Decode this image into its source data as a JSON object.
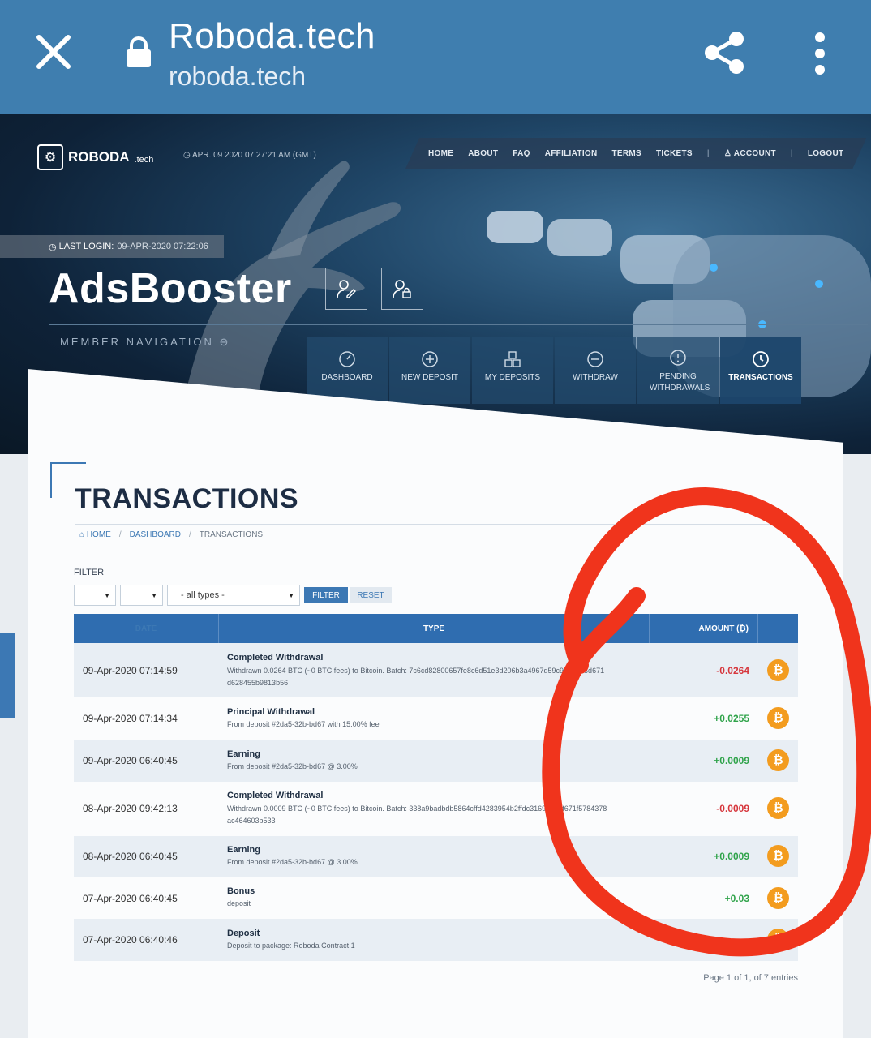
{
  "browser": {
    "title": "Roboda.tech",
    "url": "roboda.tech"
  },
  "site": {
    "brand": "ROBODA",
    "brand_suffix": ".tech",
    "clock": "APR. 09 2020 07:27:21 AM (GMT)",
    "nav": [
      "HOME",
      "ABOUT",
      "FAQ",
      "AFFILIATION",
      "TERMS",
      "TICKETS"
    ],
    "account_label": "ACCOUNT",
    "logout_label": "LOGOUT"
  },
  "member": {
    "last_login_label": "LAST LOGIN:",
    "last_login_value": "09-APR-2020 07:22:06",
    "username": "AdsBooster",
    "nav_label": "MEMBER NAVIGATION"
  },
  "tiles": [
    {
      "label": "DASHBOARD",
      "icon": "gauge-icon"
    },
    {
      "label": "NEW DEPOSIT",
      "icon": "plus-circle-icon"
    },
    {
      "label": "MY DEPOSITS",
      "icon": "cubes-icon"
    },
    {
      "label": "WITHDRAW",
      "icon": "minus-circle-icon"
    },
    {
      "label": "PENDING WITHDRAWALS",
      "icon": "alert-circle-icon"
    },
    {
      "label": "TRANSACTIONS",
      "icon": "history-icon"
    }
  ],
  "page": {
    "title": "TRANSACTIONS",
    "breadcrumb": {
      "home": "HOME",
      "dashboard": "DASHBOARD",
      "current": "TRANSACTIONS"
    }
  },
  "filter": {
    "label": "FILTER",
    "type_select": "- all types -",
    "filter_button": "FILTER",
    "reset_button": "RESET"
  },
  "table": {
    "headers": {
      "date": "DATE",
      "type": "TYPE",
      "amount": "AMOUNT (₿)"
    },
    "rows": [
      {
        "date": "09-Apr-2020 07:14:59",
        "title": "Completed Withdrawal",
        "desc": "Withdrawn 0.0264 BTC (~0 BTC fees) to Bitcoin. Batch: 7c6cd82800657fe8c6d51e3d206b3a4967d59c9383368d671d628455b9813b56",
        "amount": "-0.0264",
        "sign": "neg"
      },
      {
        "date": "09-Apr-2020 07:14:34",
        "title": "Principal Withdrawal",
        "desc": "From deposit #2da5-32b-bd67 with 15.00% fee",
        "amount": "+0.0255",
        "sign": "pos"
      },
      {
        "date": "09-Apr-2020 06:40:45",
        "title": "Earning",
        "desc": "From deposit #2da5-32b-bd67 @ 3.00%",
        "amount": "+0.0009",
        "sign": "pos"
      },
      {
        "date": "08-Apr-2020 09:42:13",
        "title": "Completed Withdrawal",
        "desc": "Withdrawn 0.0009 BTC (~0 BTC fees) to Bitcoin. Batch: 338a9badbdb5864cffd4283954b2ffdc3169e175f671f5784378ac464603b533",
        "amount": "-0.0009",
        "sign": "neg"
      },
      {
        "date": "08-Apr-2020 06:40:45",
        "title": "Earning",
        "desc": "From deposit #2da5-32b-bd67 @ 3.00%",
        "amount": "+0.0009",
        "sign": "pos"
      },
      {
        "date": "07-Apr-2020 06:40:45",
        "title": "Bonus",
        "desc": "deposit",
        "amount": "+0.03",
        "sign": "pos"
      },
      {
        "date": "07-Apr-2020 06:40:46",
        "title": "Deposit",
        "desc": "Deposit to package: Roboda Contract 1",
        "amount": "",
        "sign": "pos"
      }
    ],
    "coin_symbol": "₿"
  },
  "pager": "Page 1 of 1, of 7 entries",
  "colors": {
    "header_bar": "#3f7eaf",
    "table_head": "#2f6db0",
    "negative": "#d6363c",
    "positive": "#2fa34a",
    "coin": "#f39c1f",
    "annotation": "#f0341c"
  }
}
